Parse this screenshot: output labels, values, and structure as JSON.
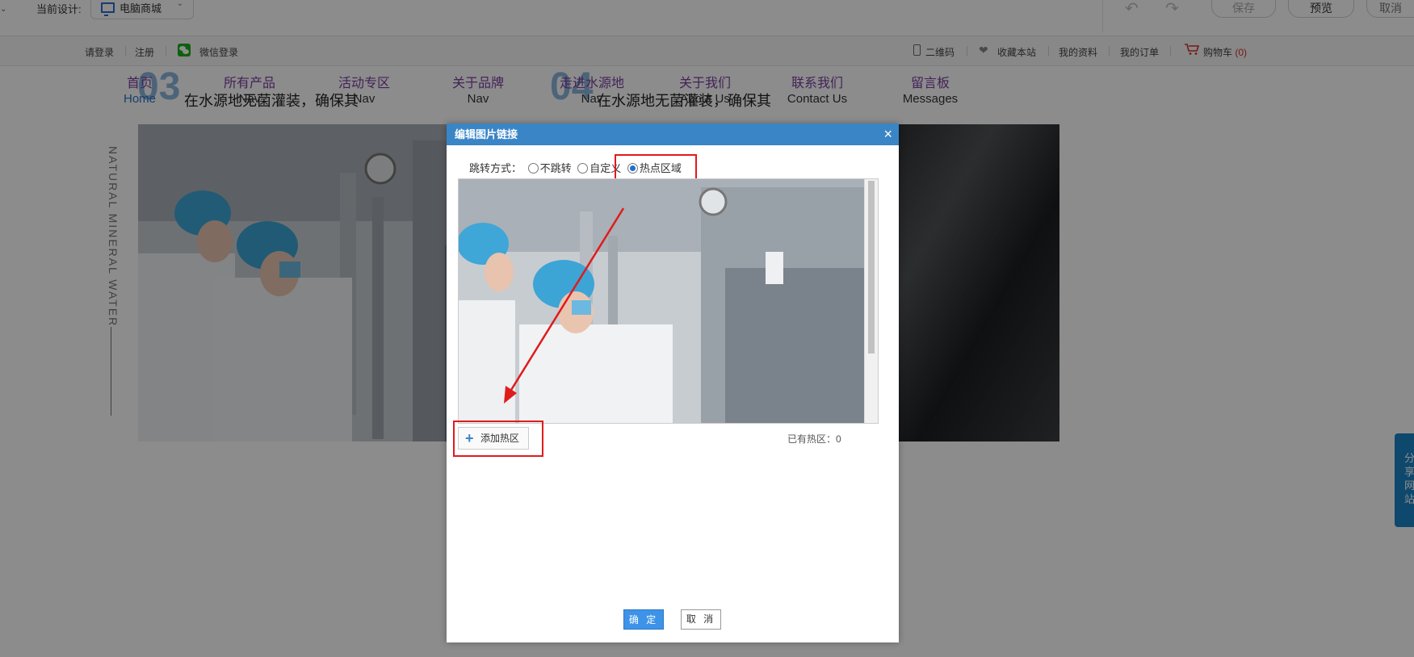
{
  "editor": {
    "design_label": "当前设计:",
    "design_value": "电脑商城",
    "save": "保存",
    "preview": "预览",
    "cancel": "取消"
  },
  "topbar": {
    "login": "请登录",
    "register": "注册",
    "wechat_login": "微信登录",
    "qrcode": "二维码",
    "favorite": "收藏本站",
    "profile": "我的资料",
    "orders": "我的订单",
    "cart": "购物车",
    "cart_count": "(0)"
  },
  "nav": {
    "items": [
      {
        "cn": "首页",
        "en": "Home"
      },
      {
        "cn": "所有产品",
        "en": "Nav"
      },
      {
        "cn": "活动专区",
        "en": "Nav"
      },
      {
        "cn": "关于品牌",
        "en": "Nav"
      },
      {
        "cn": "走进水源地",
        "en": "Nav"
      },
      {
        "cn": "关于我们",
        "en": "About Us"
      },
      {
        "cn": "联系我们",
        "en": "Contact Us"
      },
      {
        "cn": "留言板",
        "en": "Messages"
      }
    ]
  },
  "content": {
    "num_1": "03",
    "num_2": "04",
    "slogan_1": "在水源地无菌灌装，确保其",
    "slogan_2": "在水源地无菌灌装，确保其",
    "vertical_text": "NATURAL MINERAL WATER",
    "share_tab": "分享网站"
  },
  "dialog": {
    "title": "编辑图片链接",
    "close": "×",
    "jump_label": "跳转方式：",
    "options": [
      "不跳转",
      "自定义",
      "热点区域"
    ],
    "selected_option": "热点区域",
    "add_hotspot": "添加热区",
    "hotspot_count": "已有热区：0",
    "ok": "确 定",
    "cancel": "取 消"
  },
  "colors": {
    "dialog_header": "#3a85c6",
    "annotation_red": "#e01b1b",
    "nav_cn": "#7b3fa0"
  }
}
